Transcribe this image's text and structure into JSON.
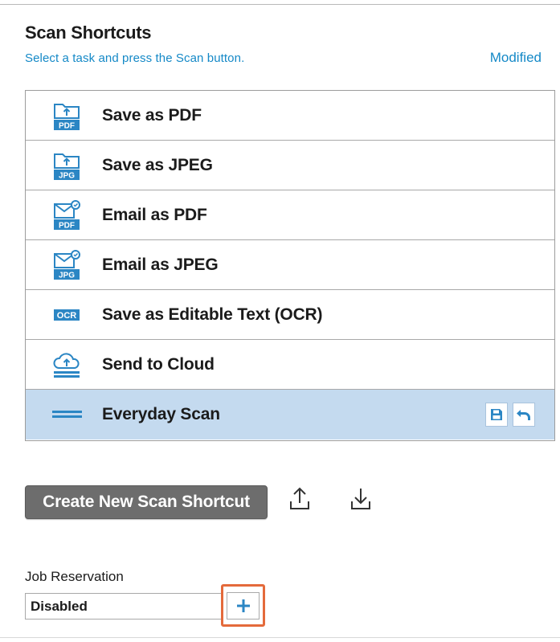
{
  "header": {
    "title": "Scan Shortcuts",
    "subtitle": "Select a task and press the Scan button.",
    "status": "Modified"
  },
  "shortcuts": [
    {
      "label": "Save as PDF",
      "icon": "folder-pdf-icon",
      "badge": "PDF"
    },
    {
      "label": "Save as JPEG",
      "icon": "folder-jpg-icon",
      "badge": "JPG"
    },
    {
      "label": "Email as PDF",
      "icon": "email-pdf-icon",
      "badge": "PDF"
    },
    {
      "label": "Email as JPEG",
      "icon": "email-jpg-icon",
      "badge": "JPG"
    },
    {
      "label": "Save as Editable Text (OCR)",
      "icon": "ocr-icon",
      "badge": "OCR"
    },
    {
      "label": "Send to Cloud",
      "icon": "cloud-upload-icon"
    },
    {
      "label": "Everyday Scan",
      "icon": "everyday-scan-icon",
      "selected": true,
      "actions": [
        "save-icon",
        "undo-icon"
      ]
    }
  ],
  "actions": {
    "create_label": "Create New Scan Shortcut",
    "export_icon": "export-icon",
    "import_icon": "import-icon"
  },
  "job_reservation": {
    "label": "Job Reservation",
    "value": "Disabled",
    "add_icon": "plus-icon"
  },
  "colors": {
    "accent": "#1589c7",
    "icon_blue": "#2b86c4",
    "selected_row": "#c4daef",
    "button_gray": "#6d6d6d",
    "highlight": "#e46a3b"
  }
}
